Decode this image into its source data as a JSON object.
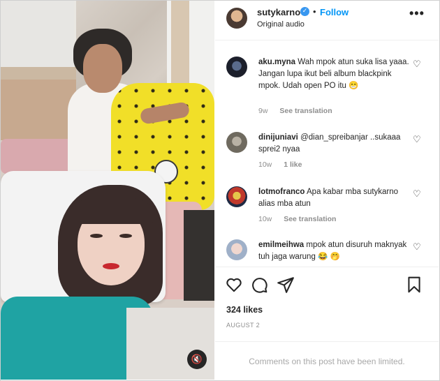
{
  "post": {
    "username": "sutykarno",
    "follow_label": "Follow",
    "separator": "•",
    "audio": "Original audio",
    "more_label": "•••",
    "mute_icon": "🔇"
  },
  "comments": [
    {
      "username": "aku.myna",
      "text": "Wah mpok atun suka lisa yaaa. Jangan lupa ikut beli album blackpink mpok. Udah open PO itu 😁",
      "time": "9w",
      "likes": "",
      "action": "See translation"
    },
    {
      "username": "dinijuniavi",
      "text": "@dian_spreibanjar ..sukaaa sprei2 nyaa",
      "time": "10w",
      "likes": "1 like",
      "action": ""
    },
    {
      "username": "lotmofranco",
      "text": "Apa kabar mba sutykarno alias mba atun",
      "time": "10w",
      "likes": "",
      "action": "See translation"
    },
    {
      "username": "emilmeihwa",
      "text": "mpok atun disuruh maknyak tuh jaga warung 😂 🤭",
      "time": "",
      "likes": "",
      "action": ""
    }
  ],
  "footer": {
    "likes": "324 likes",
    "date": "AUGUST 2",
    "limited": "Comments on this post have been limited."
  },
  "icons": [
    "heart-icon",
    "comment-icon",
    "share-icon",
    "bookmark-icon",
    "more-icon",
    "verified-icon",
    "mute-icon"
  ],
  "colors": {
    "link_blue": "#0095f6",
    "verified_blue": "#3897f0",
    "muted_text": "#8e8e8e"
  }
}
